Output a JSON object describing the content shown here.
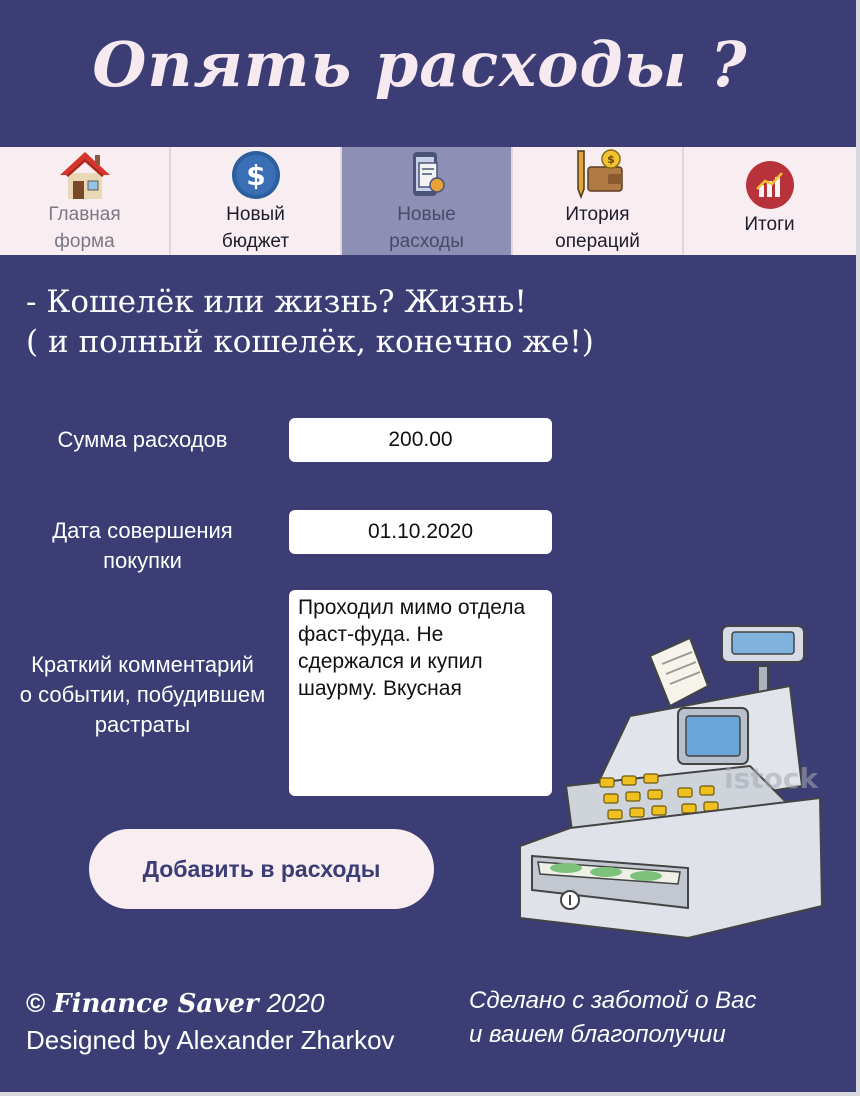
{
  "header": {
    "title": "Опять расходы ?"
  },
  "nav": {
    "items": [
      {
        "label": "Главная\nформа",
        "icon": "house-icon"
      },
      {
        "label": "Новый\nбюджет",
        "icon": "dollar-coin-icon"
      },
      {
        "label": "Новые\nрасходы",
        "icon": "receipt-phone-icon",
        "active": true
      },
      {
        "label": "Итория\nопераций",
        "icon": "wallet-pen-icon"
      },
      {
        "label": "Итоги",
        "icon": "chart-growth-icon"
      }
    ]
  },
  "slogan": "- Кошелёк или жизнь? Жизнь!\n( и полный кошелёк, конечно же!)",
  "form": {
    "amount_label": "Сумма расходов",
    "amount_value": "200.00",
    "date_label": "Дата совершения\nпокупки",
    "date_value": "01.10.2020",
    "comment_label": "Краткий комментарий\nо событии, побудившем\nрастраты",
    "comment_value": "Проходил мимо отдела фаст-фуда. Не сдержался и купил шаурму. Вкусная",
    "submit_label": "Добавить в расходы"
  },
  "illustration": {
    "name": "cash-register-icon",
    "watermark": "istock"
  },
  "footer": {
    "copyright_symbol": "©",
    "brand": "Finance Saver",
    "year": "2020",
    "designer": "Designed by Alexander Zharkov",
    "tagline": "Сделано с заботой о Вас\nи вашем благополучии"
  },
  "colors": {
    "background": "#3b3d74",
    "nav": "#f8eef1",
    "nav_active": "#8d8fb4",
    "button": "#f8eef1"
  }
}
